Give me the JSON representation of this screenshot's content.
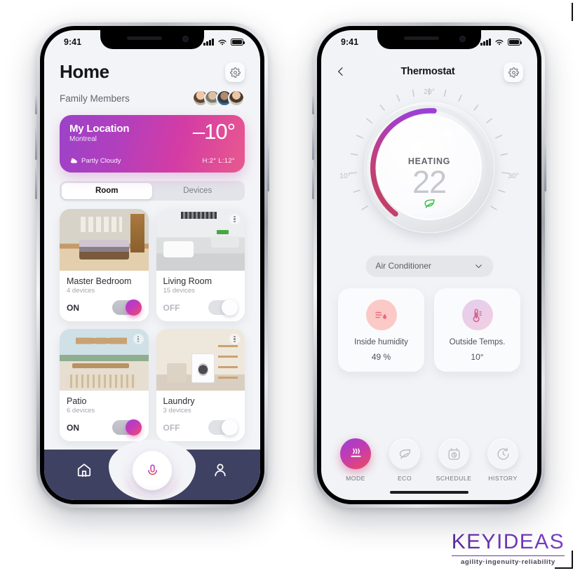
{
  "statusbar": {
    "time": "9:41"
  },
  "home": {
    "title": "Home",
    "gear_icon": "gear-icon",
    "family_label": "Family Members",
    "avatars": [
      "avatar-1",
      "avatar-2",
      "avatar-3",
      "avatar-4"
    ],
    "weather": {
      "name": "My Location",
      "city": "Montreal",
      "temp": "–10°",
      "condition": "Partly Cloudy",
      "condition_icon": "partly-cloudy-icon",
      "high_low": "H:2°  L:12°",
      "gradient_from": "#9b42c8",
      "gradient_to": "#e85a8e"
    },
    "tabs": [
      {
        "label": "Room",
        "active": true
      },
      {
        "label": "Devices",
        "active": false
      }
    ],
    "rooms": [
      {
        "name": "Master Bedroom",
        "devices": "4 devices",
        "state": "ON",
        "on": true
      },
      {
        "name": "Living Room",
        "devices": "15 devices",
        "state": "OFF",
        "on": false
      },
      {
        "name": "Patio",
        "devices": "6 devices",
        "state": "ON",
        "on": true
      },
      {
        "name": "Laundry",
        "devices": "3 devices",
        "state": "OFF",
        "on": false
      }
    ],
    "nav": [
      {
        "name": "home-tab",
        "icon": "home-icon"
      },
      {
        "name": "voice-tab",
        "icon": "microphone-icon"
      },
      {
        "name": "profile-tab",
        "icon": "person-icon"
      }
    ]
  },
  "thermostat": {
    "back_icon": "chevron-left-icon",
    "title": "Thermostat",
    "gear_icon": "gear-icon",
    "dial": {
      "mode": "HEATING",
      "temperature": "22",
      "eco_icon": "leaf-icon",
      "label_top": "20°",
      "label_left": "10°",
      "label_right": "30°",
      "arc_start_color": "#c2415e",
      "arc_end_color": "#9b3fd8"
    },
    "device_selector": {
      "value": "Air Conditioner",
      "chevron": "chevron-down-icon"
    },
    "stats": [
      {
        "label": "Inside humidity",
        "value": "49 %",
        "icon": "humidity-icon",
        "color": "#fbc9c6"
      },
      {
        "label": "Outside Temps.",
        "value": "10°",
        "icon": "thermometer-icon",
        "color": "#e8cfe9"
      }
    ],
    "tabs": [
      {
        "label": "MODE",
        "icon": "heat-waves-icon",
        "active": true
      },
      {
        "label": "ECO",
        "icon": "leaf-icon",
        "active": false
      },
      {
        "label": "SCHEDULE",
        "icon": "calendar-clock-icon",
        "active": false
      },
      {
        "label": "HISTORY",
        "icon": "clock-arrow-icon",
        "active": false
      }
    ]
  },
  "branding": {
    "name": "KEYIDEAS",
    "tagline": "agility·ingenuity·reliability"
  }
}
